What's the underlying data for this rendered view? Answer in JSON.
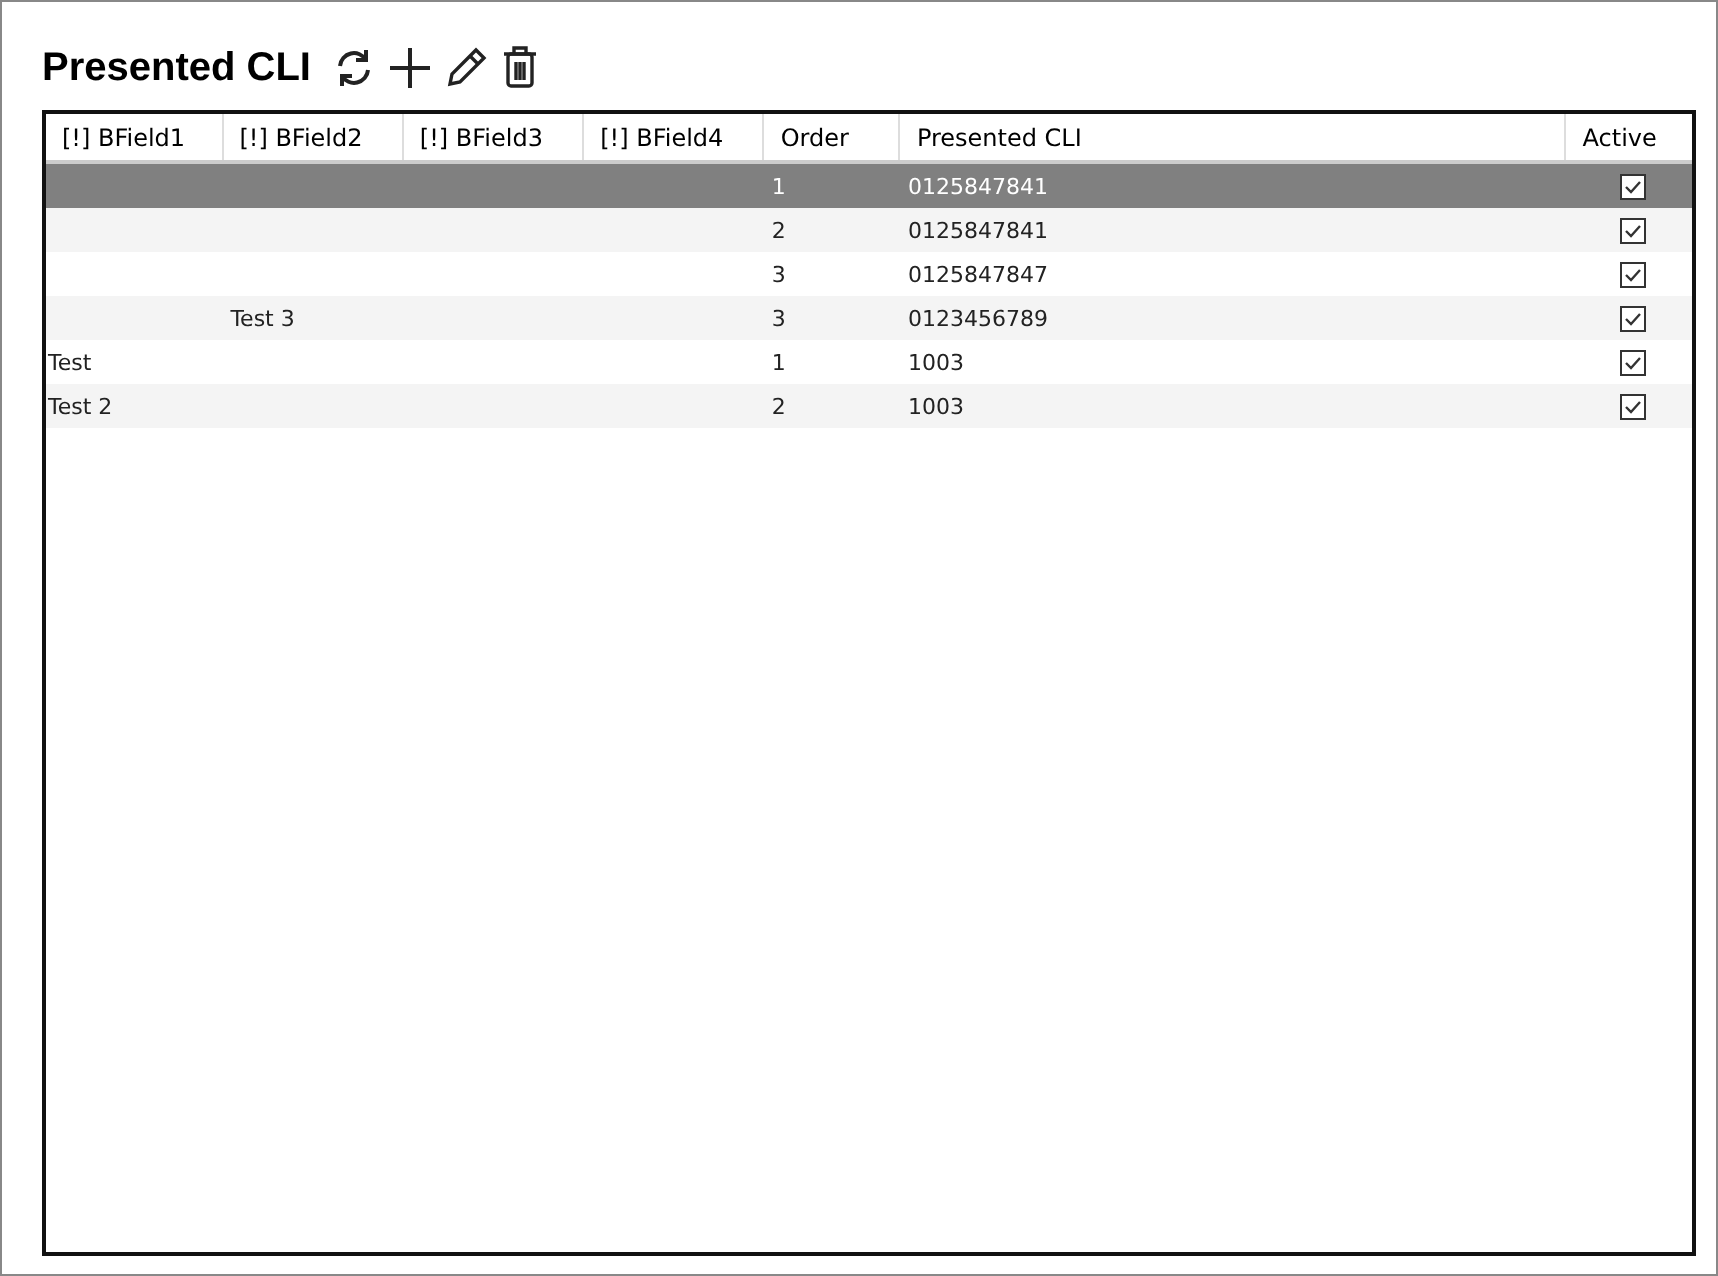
{
  "page": {
    "title": "Presented CLI"
  },
  "table": {
    "columns": [
      "[!] BField1",
      "[!] BField2",
      "[!] BField3",
      "[!] BField4",
      "Order",
      "Presented CLI",
      "Active"
    ],
    "rows": [
      {
        "cells": [
          "",
          "",
          "",
          "",
          "1",
          "0125847841"
        ],
        "active": true,
        "selected": true
      },
      {
        "cells": [
          "",
          "",
          "",
          "",
          "2",
          "0125847841"
        ],
        "active": true,
        "selected": false
      },
      {
        "cells": [
          "",
          "",
          "",
          "",
          "3",
          "0125847847"
        ],
        "active": true,
        "selected": false
      },
      {
        "cells": [
          "",
          "Test 3",
          "",
          "",
          "3",
          "0123456789"
        ],
        "active": true,
        "selected": false
      },
      {
        "cells": [
          "Test",
          "",
          "",
          "",
          "1",
          "1003"
        ],
        "active": true,
        "selected": false
      },
      {
        "cells": [
          "Test 2",
          "",
          "",
          "",
          "2",
          "1003"
        ],
        "active": true,
        "selected": false
      }
    ]
  }
}
